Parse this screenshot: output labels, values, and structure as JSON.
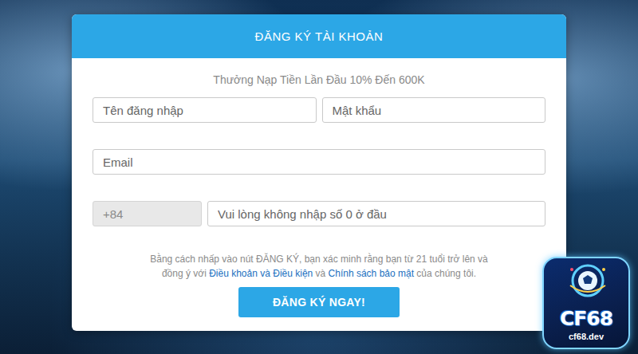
{
  "form": {
    "title": "ĐĂNG KÝ TÀI KHOẢN",
    "promo": "Thưởng Nạp Tiền Lần Đầu 10% Đến 600K",
    "credentials": [
      {
        "name": "username",
        "placeholder": "Tên đăng nhập"
      },
      {
        "name": "password",
        "placeholder": "Mật khẩu"
      }
    ],
    "email": {
      "placeholder": "Email"
    },
    "phone": {
      "prefix": "+84",
      "placeholder": "Vui lòng không nhập số 0 ở đầu"
    },
    "terms": [
      [
        {
          "text": "Bằng cách nhấp vào nút ĐĂNG KÝ, bạn xác minh rằng bạn từ 21 tuổi trở lên và",
          "link": false
        }
      ],
      [
        {
          "text": "đồng ý với ",
          "link": false
        },
        {
          "text": "Điều khoản và Điều kiện",
          "link": true
        },
        {
          "text": " và ",
          "link": false
        },
        {
          "text": "Chính sách bảo mật",
          "link": true
        },
        {
          "text": " của chúng tôi.",
          "link": false
        }
      ]
    ],
    "submit": "ĐĂNG KÝ NGAY!"
  },
  "logo": {
    "name": "CF68",
    "domain": "cf68.dev"
  }
}
